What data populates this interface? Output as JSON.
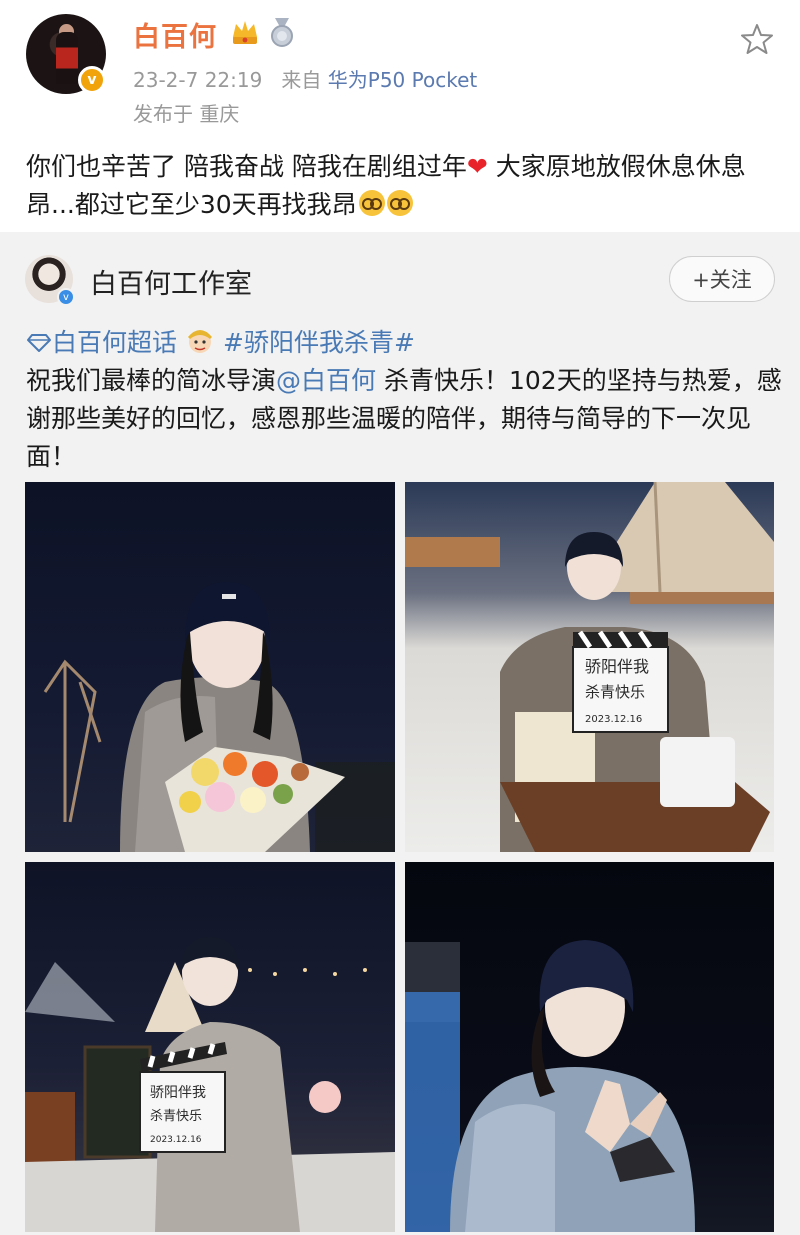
{
  "post": {
    "username": "白百何",
    "date": "23-2-7 22:19",
    "from_label": "来自",
    "device": "华为P50 Pocket",
    "location": "发布于 重庆",
    "verify_mark": "v",
    "text_part1": "你们也辛苦了 陪我奋战 陪我在剧组过年",
    "text_part2": " 大家原地放假休息休息昂...都过它至少30天再找我昂",
    "heart_emoji": "❤"
  },
  "repost": {
    "author": "白百何工作室",
    "follow_label": "+关注",
    "verify_mark": "v",
    "super_topic": "白百何超话",
    "hashtag": "#骄阳伴我杀青#",
    "mention": "@白百何",
    "text_before_mention": "祝我们最棒的简冰导演",
    "text_after_mention": " 杀青快乐！102天的坚持与热爱，感谢那些美好的回忆，感恩那些温暖的陪伴，期待与简导的下一次见面！",
    "photos": [
      {
        "name": "photo-bouquet"
      },
      {
        "name": "photo-sled-clapperboard"
      },
      {
        "name": "photo-standing-clapperboard"
      },
      {
        "name": "photo-hands-closeup"
      }
    ],
    "clapper_title": "骄阳伴我",
    "clapper_sub": "杀青快乐",
    "clapper_date": "2023.12.16"
  },
  "colors": {
    "username": "#eb7340",
    "link": "#4a7ab5",
    "device": "#5b7ab0",
    "meta": "#999999",
    "repost_bg": "#f2f2f2"
  },
  "icons": [
    "crown-icon",
    "medal-icon",
    "star-icon",
    "diamond-icon",
    "sticker-icon",
    "nerd-face-icon",
    "heart-icon"
  ]
}
